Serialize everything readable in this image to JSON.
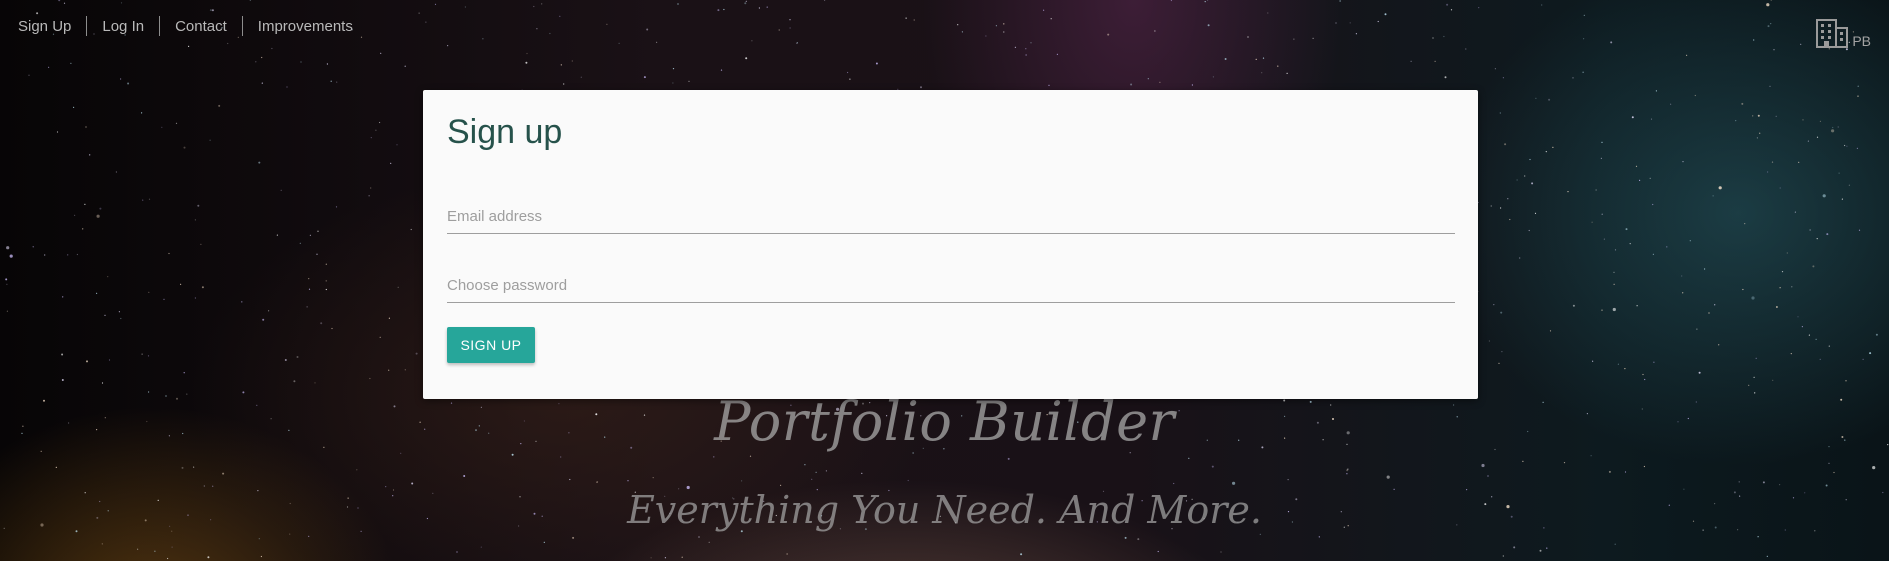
{
  "nav": {
    "items": [
      {
        "label": "Sign Up"
      },
      {
        "label": "Log In"
      },
      {
        "label": "Contact"
      },
      {
        "label": "Improvements"
      }
    ]
  },
  "brand": {
    "icon": "building-icon",
    "text": "PB"
  },
  "signup": {
    "title": "Sign up",
    "email_placeholder": "Email address",
    "password_placeholder": "Choose password",
    "submit_label": "SIGN UP"
  },
  "hero": {
    "title": "Portfolio Builder",
    "subtitle": "Everything You Need. And More."
  },
  "colors": {
    "accent": "#26a69a",
    "title": "#26524b",
    "card": "#fafafa"
  }
}
